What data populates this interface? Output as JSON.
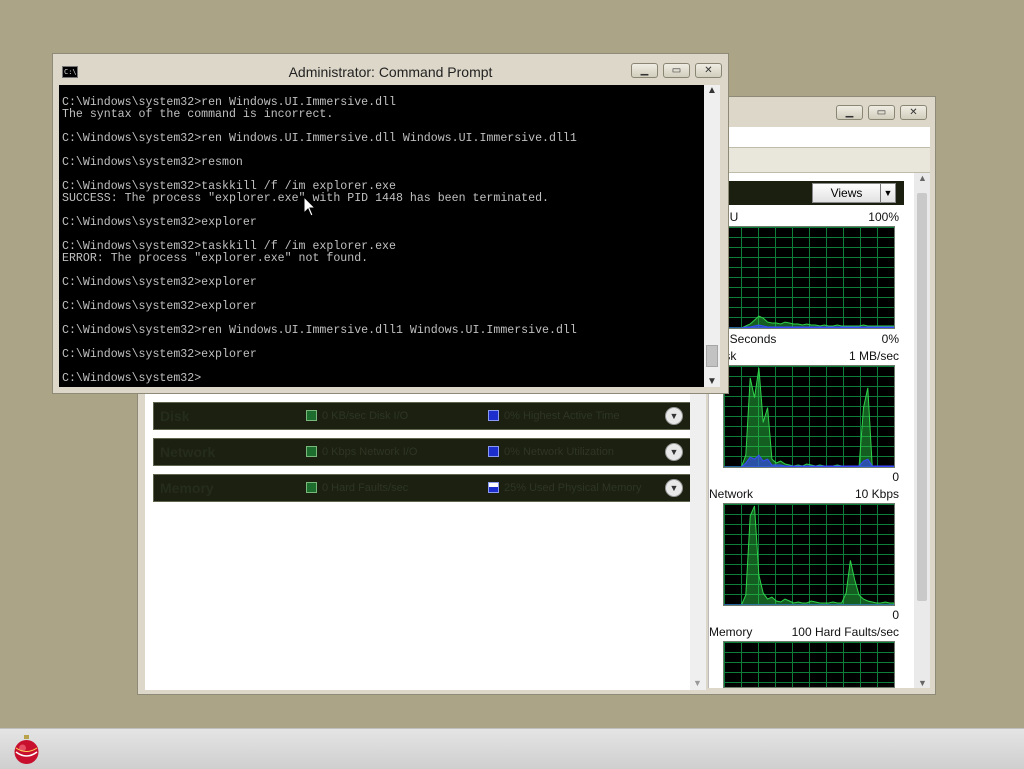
{
  "resmon": {
    "rows": [
      {
        "title": "Disk",
        "stat1": "0 KB/sec Disk I/O",
        "stat2": "0% Highest Active Time"
      },
      {
        "title": "Network",
        "stat1": "0 Kbps Network I/O",
        "stat2": "0% Network Utilization"
      },
      {
        "title": "Memory",
        "stat1": "0 Hard Faults/sec",
        "stat2": "25% Used Physical Memory"
      }
    ],
    "views_label": "Views",
    "graphs": [
      {
        "name": "CPU",
        "max": "100%",
        "footer_left": "60 Seconds",
        "footer_right": "0%",
        "values_green": [
          0,
          0,
          0,
          0,
          0,
          2,
          4,
          8,
          12,
          10,
          6,
          5,
          5,
          4,
          6,
          5,
          4,
          4,
          3,
          4,
          3,
          3,
          2,
          3,
          2,
          2,
          3,
          2,
          2,
          2,
          2,
          2,
          3,
          2,
          2,
          2,
          2,
          2,
          2,
          2
        ],
        "values_blue": [
          0,
          0,
          0,
          0,
          0,
          1,
          1,
          2,
          3,
          2,
          1,
          1,
          1,
          1,
          1,
          1,
          1,
          1,
          1,
          1,
          1,
          1,
          1,
          1,
          1,
          1,
          1,
          1,
          1,
          1,
          1,
          1,
          1,
          1,
          1,
          1,
          1,
          1,
          1,
          1
        ]
      },
      {
        "name": "Disk",
        "max": "1 MB/sec",
        "footer_right": "0",
        "values_green": [
          0,
          0,
          0,
          0,
          0,
          12,
          90,
          70,
          100,
          45,
          60,
          8,
          4,
          6,
          3,
          2,
          1,
          2,
          1,
          3,
          2,
          1,
          2,
          1,
          1,
          1,
          2,
          1,
          1,
          1,
          1,
          1,
          60,
          80,
          1,
          1,
          1,
          1,
          1,
          1
        ],
        "values_blue": [
          0,
          0,
          0,
          0,
          0,
          4,
          10,
          8,
          12,
          6,
          8,
          2,
          2,
          2,
          1,
          1,
          1,
          1,
          1,
          1,
          1,
          1,
          1,
          1,
          1,
          1,
          1,
          1,
          1,
          1,
          1,
          1,
          6,
          8,
          1,
          1,
          1,
          1,
          1,
          1
        ]
      },
      {
        "name": "Network",
        "max": "10 Kbps",
        "footer_right": "0",
        "values_green": [
          0,
          0,
          0,
          0,
          0,
          10,
          90,
          100,
          30,
          12,
          6,
          8,
          4,
          3,
          6,
          4,
          2,
          3,
          2,
          2,
          4,
          3,
          2,
          2,
          2,
          3,
          2,
          2,
          12,
          45,
          25,
          10,
          6,
          4,
          3,
          2,
          2,
          3,
          2,
          2
        ],
        "values_blue": [
          0,
          0,
          0,
          0,
          0,
          0,
          0,
          0,
          0,
          0,
          0,
          0,
          0,
          0,
          0,
          0,
          0,
          0,
          0,
          0,
          0,
          0,
          0,
          0,
          0,
          0,
          0,
          0,
          0,
          0,
          0,
          0,
          0,
          0,
          0,
          0,
          0,
          0,
          0,
          0
        ]
      },
      {
        "name": "Memory",
        "max": "100 Hard Faults/sec",
        "values_green": [],
        "values_blue": []
      }
    ]
  },
  "cmd": {
    "title": "Administrator: Command Prompt",
    "lines": [
      "C:\\Windows\\system32>ren Windows.UI.Immersive.dll",
      "The syntax of the command is incorrect.",
      "",
      "C:\\Windows\\system32>ren Windows.UI.Immersive.dll Windows.UI.Immersive.dll1",
      "",
      "C:\\Windows\\system32>resmon",
      "",
      "C:\\Windows\\system32>taskkill /f /im explorer.exe",
      "SUCCESS: The process \"explorer.exe\" with PID 1448 has been terminated.",
      "",
      "C:\\Windows\\system32>explorer",
      "",
      "C:\\Windows\\system32>taskkill /f /im explorer.exe",
      "ERROR: The process \"explorer.exe\" not found.",
      "",
      "C:\\Windows\\system32>explorer",
      "",
      "C:\\Windows\\system32>explorer",
      "",
      "C:\\Windows\\system32>ren Windows.UI.Immersive.dll1 Windows.UI.Immersive.dll",
      "",
      "C:\\Windows\\system32>explorer",
      "",
      "C:\\Windows\\system32>"
    ]
  },
  "icons": {
    "minimize": "minimize-icon",
    "maximize": "maximize-icon",
    "close": "close-icon",
    "start": "ornament-start-orb-icon",
    "cmd": "cmd-window-icon"
  },
  "colors": {
    "desktop": "#aba487",
    "graph_line_green": "#2fd14a",
    "graph_line_blue": "#3a49ff",
    "row_bar": "#1b2010"
  }
}
